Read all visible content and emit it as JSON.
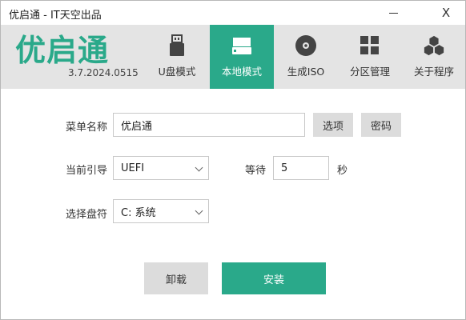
{
  "window": {
    "title": "优启通 - IT天空出品",
    "minimize_icon": "minimize-icon",
    "close_label": "X"
  },
  "header": {
    "logo_text": "优启通",
    "version": "3.7.2024.0515",
    "tabs": [
      {
        "label": "U盘模式",
        "icon": "usb-icon",
        "active": false
      },
      {
        "label": "本地模式",
        "icon": "hard-drive-icon",
        "active": true
      },
      {
        "label": "生成ISO",
        "icon": "disc-icon",
        "active": false
      },
      {
        "label": "分区管理",
        "icon": "grid-icon",
        "active": false
      },
      {
        "label": "关于程序",
        "icon": "hexagons-icon",
        "active": false
      }
    ]
  },
  "form": {
    "menu_name_label": "菜单名称",
    "menu_name_value": "优启通",
    "options_button": "选项",
    "password_button": "密码",
    "boot_label": "当前引导",
    "boot_value": "UEFI",
    "wait_label": "等待",
    "wait_value": "5",
    "wait_unit": "秒",
    "drive_label": "选择盘符",
    "drive_value": "C: 系统"
  },
  "actions": {
    "uninstall": "卸载",
    "install": "安装"
  },
  "colors": {
    "accent": "#2aa98a",
    "header_bg": "#e4e4e4",
    "button_gray": "#dcdcdc"
  }
}
